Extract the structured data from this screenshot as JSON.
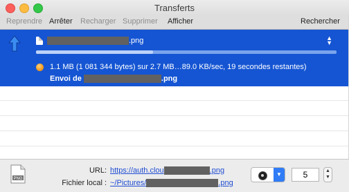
{
  "window": {
    "title": "Transferts"
  },
  "toolbar": {
    "reprendre": "Reprendre",
    "arreter": "Arrêter",
    "recharger": "Recharger",
    "supprimer": "Supprimer",
    "afficher": "Afficher",
    "rechercher": "Rechercher"
  },
  "transfer": {
    "file_suffix": ".png",
    "progress_fraction": 0.39,
    "status": "1.1 MB (1 081 344 bytes) sur 2.7 MB…89.0 KB/sec, 19 secondes restantes)",
    "envoi_prefix": "Envoi de ",
    "envoi_suffix": ".png"
  },
  "details": {
    "url_label": "URL:",
    "url_prefix": "https://auth.clou",
    "url_suffix": ".png",
    "local_label": "Fichier local :",
    "local_prefix": "~/Pictures/",
    "local_suffix": ".png",
    "file_type": "PNG"
  },
  "stepper": {
    "value": "5"
  },
  "colors": {
    "selection": "#1555d3",
    "accent": "#2f7cf6",
    "link": "#1d4bd2"
  }
}
